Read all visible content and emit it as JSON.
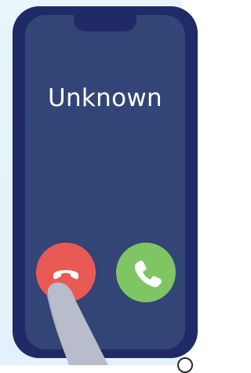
{
  "call": {
    "caller_name": "Unknown"
  },
  "actions": {
    "decline_icon": "phone-hangup-icon",
    "accept_icon": "phone-icon"
  },
  "colors": {
    "phone_frame": "#1f2a66",
    "screen": "#324576",
    "decline": "#e95a55",
    "accept": "#7fc564",
    "finger": "#b8bccb",
    "background": "#e6f2fa"
  }
}
